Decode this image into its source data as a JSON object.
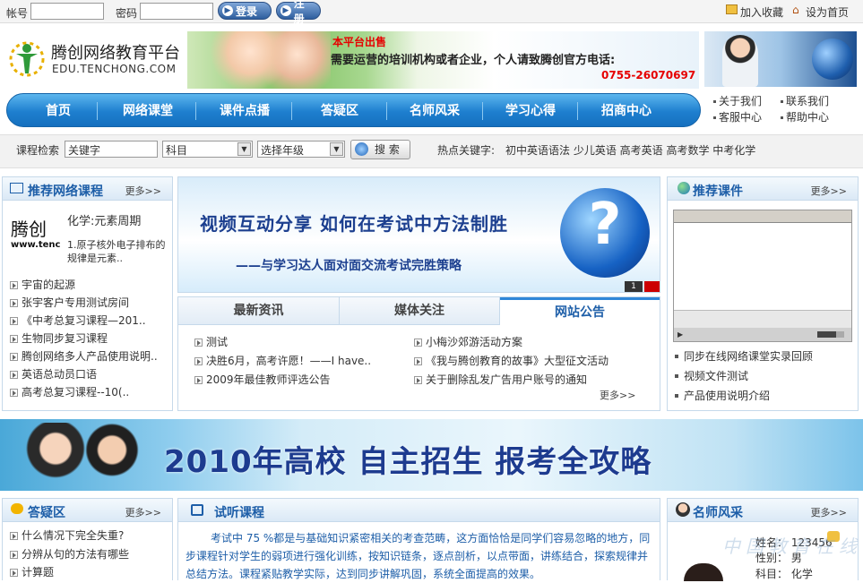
{
  "top": {
    "account_label": "帐号",
    "password_label": "密码",
    "login_label": "登录",
    "register_label": "注册",
    "favorite_label": "加入收藏",
    "homepage_label": "设为首页"
  },
  "brand": {
    "name": "腾创网络教育平台",
    "domain": "EDU.TENCHONG.COM"
  },
  "banner": {
    "sale": "本平台出售",
    "message": "需要运营的培训机构或者企业，个人请致腾创官方电话:",
    "phone": "0755-26070697"
  },
  "quicklinks": [
    "关于我们",
    "联系我们",
    "客服中心",
    "帮助中心"
  ],
  "nav": [
    "首页",
    "网络课堂",
    "课件点播",
    "答疑区",
    "名师风采",
    "学习心得",
    "招商中心"
  ],
  "search": {
    "label": "课程检索",
    "keyword": "关键字",
    "subject": "科目",
    "grade": "选择年级",
    "button": "搜 索",
    "hot_label": "热点关键字:",
    "hot_words": "初中英语语法 少儿英语 高考英语 高考数学 中考化学"
  },
  "courses": {
    "title": "推荐网络课程",
    "more": "更多>>",
    "featured_title": "化学:元素周期",
    "featured_desc": "1.原子核外电子排布的规律是元素..",
    "thumb_text": "腾创",
    "thumb_sub": "www.tenc",
    "items": [
      "宇宙的起源",
      "张宇客户专用测试房间",
      "《中考总复习课程—201..",
      "生物同步复习课程",
      "腾创网络多人产品使用说明..",
      "英语总动员口语",
      "高考总复习课程--10(.."
    ]
  },
  "slide": {
    "line1": "视频互动分享  如何在考试中方法制胜",
    "line2": "——与学习达人面对面交流考试完胜策略",
    "page": "1"
  },
  "news": {
    "tabs": [
      "最新资讯",
      "媒体关注",
      "网站公告"
    ],
    "left": [
      "测试",
      "决胜6月，高考许愿！——I have..",
      "2009年最佳教师评选公告"
    ],
    "right": [
      "小梅沙郊游活动方案",
      "《我与腾创教育的故事》大型征文活动",
      "关于删除乱发广告用户账号的通知"
    ],
    "more": "更多>>"
  },
  "courseware": {
    "title": "推荐课件",
    "more": "更多>>",
    "items": [
      "同步在线网络课堂实录回顾",
      "视频文件测试",
      "产品使用说明介绍"
    ]
  },
  "wide_banner": {
    "text": "2010年高校 自主招生 报考全攻略"
  },
  "qa": {
    "title": "答疑区",
    "more": "更多>>",
    "items": [
      "什么情况下完全失重?",
      "分辨从句的方法有哪些",
      "计算题"
    ]
  },
  "trial": {
    "title": "试听课程",
    "text": "考试中 75 %都是与基础知识紧密相关的考查范畴，这方面恰恰是同学们容易忽略的地方，同步课程针对学生的弱项进行强化训练，按知识链条，逐点剖析，以点带面，讲练结合，探索规律并总结方法。课程紧贴教学实际，达到同步讲解巩固，系统全面提高的效果。"
  },
  "teacher": {
    "title": "名师风采",
    "more": "更多>>",
    "name": "姓名：  123456",
    "gender": "性别：  男",
    "subject": "科目：  化学"
  },
  "watermark": "中国教育在线",
  "colors": {
    "nav": "#1e7fcf",
    "panel_title": "#1d5ea8",
    "phone": "#e60000",
    "banner_text": "#1d3b8f"
  }
}
